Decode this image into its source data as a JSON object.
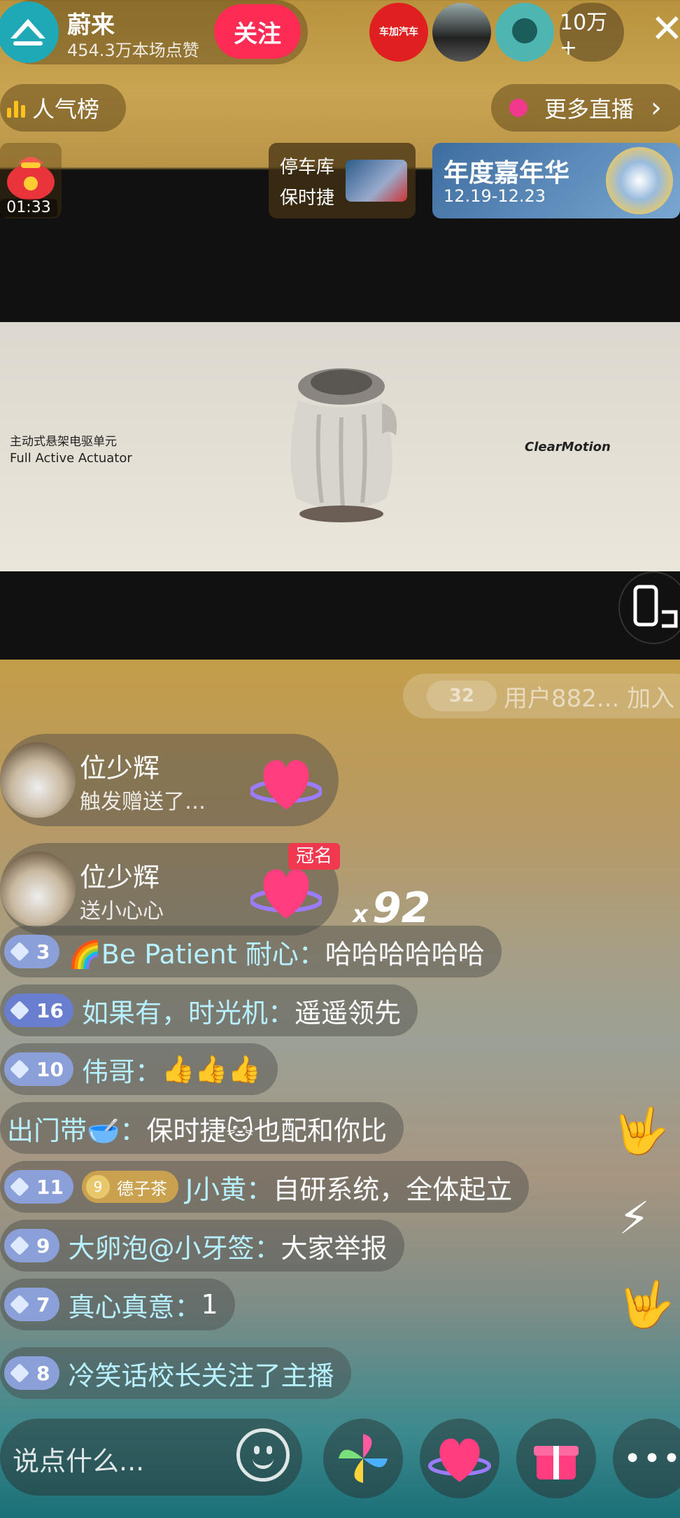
{
  "header": {
    "host_name": "蔚来",
    "host_likes": "454.3万本场点赞",
    "follow_label": "关注",
    "viewer_count": "10万+",
    "close_glyph": "✕",
    "viewers": [
      {
        "label": "车加汽车",
        "color": "#e02020"
      },
      {
        "label": "",
        "color": "#3a3a3a"
      },
      {
        "label": "",
        "color": "#4fb5b1"
      }
    ]
  },
  "row2": {
    "rank_label": "人气榜",
    "more_live_label": "更多直播",
    "more_chevron": "›"
  },
  "promo": {
    "gift_timer": "01:33",
    "garage_title": "停车库",
    "garage_sub": "保时捷",
    "carnival_title": "年度嘉年华",
    "carnival_dates": "12.19-12.23"
  },
  "video": {
    "caption_cn": "主动式悬架电驱单元",
    "caption_en": "Full Active Actuator",
    "brand": "ClearMotion"
  },
  "chat": {
    "join_level": "32",
    "join_text": "用户882... 加入",
    "gift_events": [
      {
        "name": "位少辉",
        "desc": "触发赠送了…"
      },
      {
        "name": "位少辉",
        "desc": "送小心心",
        "tag": "冠名"
      }
    ],
    "combo_prefix": "x",
    "combo_count": "92",
    "messages": [
      {
        "level": "3",
        "user": "🌈Be Patient 耐心：",
        "text": "哈哈哈哈哈哈"
      },
      {
        "level": "16",
        "user": "如果有，时光机：",
        "text": "遥遥领先"
      },
      {
        "level": "10",
        "user": "伟哥：",
        "text": "👍👍👍"
      },
      {
        "level": "",
        "user": "出门带🥣：",
        "text": "保时捷🐱也配和你比"
      },
      {
        "level": "11",
        "fan_badge": "德子茶",
        "fan_level": "9",
        "user": "J小黄：",
        "text": "自研系统，全体起立"
      },
      {
        "level": "9",
        "user": "大卵泡@小牙签：",
        "text": "大家举报"
      },
      {
        "level": "7",
        "user": "真心真意：",
        "text": "1"
      },
      {
        "level": "8",
        "user": "冷笑话校长",
        "text": " 关注了主播"
      }
    ],
    "side_emojis": [
      "🤟",
      "⚡",
      "🤟"
    ]
  },
  "bottom": {
    "input_placeholder": "说点什么...",
    "more_glyph": "•••"
  },
  "colors": {
    "follow": "#fe2c55",
    "username": "#b7f0ff",
    "level_badge": "#8b9fd8",
    "rank_bars": "#ffc21c"
  }
}
